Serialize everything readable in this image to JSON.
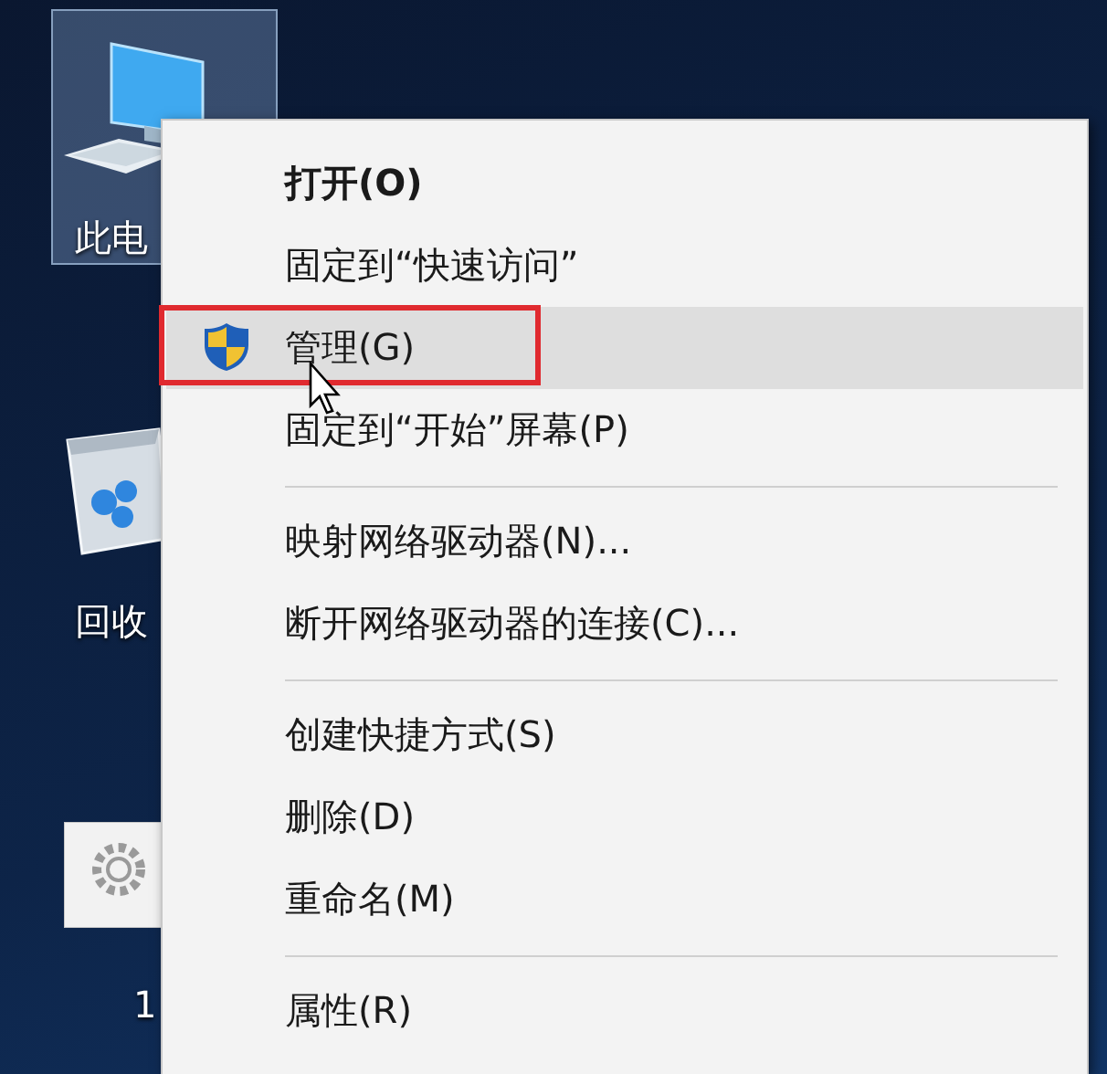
{
  "desktop": {
    "icons": [
      {
        "kind": "computer",
        "label": "此电",
        "selected": true
      },
      {
        "kind": "recycle_bin",
        "label": "回收",
        "selected": false
      },
      {
        "kind": "settings_file",
        "label": "1",
        "selected": false
      }
    ]
  },
  "context_menu": {
    "items": [
      {
        "kind": "command",
        "label": "打开(O)",
        "default": true,
        "highlighted": false,
        "annotated": false
      },
      {
        "kind": "command",
        "label": "固定到“快速访问”",
        "default": false,
        "highlighted": false,
        "annotated": false
      },
      {
        "kind": "admin_command",
        "label": "管理(G)",
        "default": false,
        "highlighted": true,
        "annotated": true
      },
      {
        "kind": "command",
        "label": "固定到“开始”屏幕(P)",
        "default": false,
        "highlighted": false,
        "annotated": false
      },
      {
        "kind": "separator"
      },
      {
        "kind": "command",
        "label": "映射网络驱动器(N)...",
        "default": false,
        "highlighted": false,
        "annotated": false
      },
      {
        "kind": "command",
        "label": "断开网络驱动器的连接(C)...",
        "default": false,
        "highlighted": false,
        "annotated": false
      },
      {
        "kind": "separator"
      },
      {
        "kind": "command",
        "label": "创建快捷方式(S)",
        "default": false,
        "highlighted": false,
        "annotated": false
      },
      {
        "kind": "command",
        "label": "删除(D)",
        "default": false,
        "highlighted": false,
        "annotated": false
      },
      {
        "kind": "command",
        "label": "重命名(M)",
        "default": false,
        "highlighted": false,
        "annotated": false
      },
      {
        "kind": "separator"
      },
      {
        "kind": "command",
        "label": "属性(R)",
        "default": false,
        "highlighted": false,
        "annotated": false
      }
    ]
  }
}
